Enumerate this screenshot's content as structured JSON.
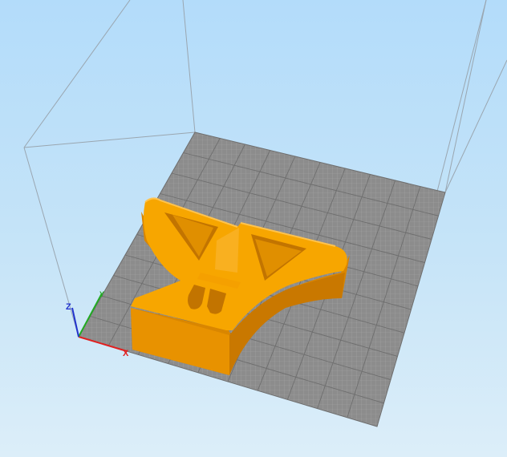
{
  "viewport": {
    "background_top": "#b3dcfa",
    "background_bottom": "#dceef9"
  },
  "build_plate": {
    "color": "#8c8c8c",
    "grid_minor_color": "#a4a4a4",
    "grid_major_color": "#6e6e6e"
  },
  "model": {
    "color": "#f7a600",
    "shade_color": "#d98600",
    "dark_color": "#b86a00"
  },
  "axes": {
    "x_label": "X",
    "y_label": "Y",
    "z_label": "Z",
    "x_color": "#e02020",
    "y_color": "#22aa22",
    "z_color": "#2233cc"
  }
}
